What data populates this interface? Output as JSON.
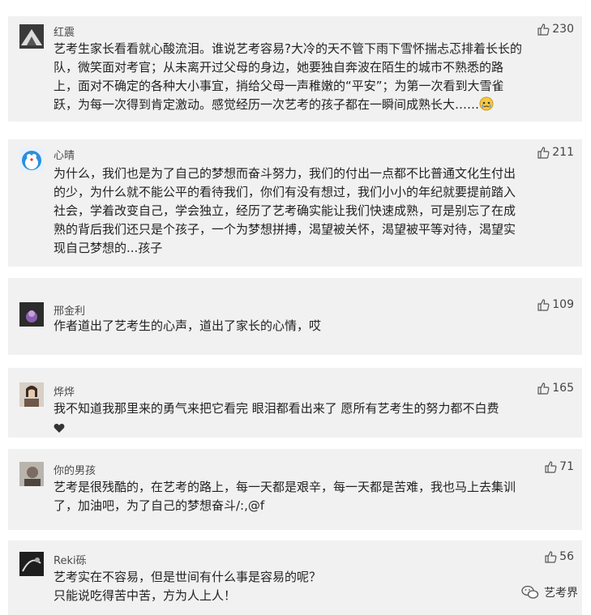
{
  "comments": [
    {
      "username": "红震",
      "likes": "230",
      "text": "艺考生家长看看就心酸流泪。谁说艺考容易?大冷的天不管下雨下雪怀揣忐忑排着长长的\n队，微笑面对考官；从未离开过父母的身边，她要独自奔波在陌生的城市不熟悉的路\n上，面对不确定的各种大小事宜，捎给父母一声稚嫩的“平安”；为第一次看到大雪雀\n跃，为每一次得到肯定激动。感觉经历一次艺考的孩子都在一瞬间成熟长大……"
    },
    {
      "username": "心晴",
      "likes": "211",
      "text": "为什么，我们也是为了自己的梦想而奋斗努力，我们的付出一点都不比普通文化生付出\n的少，为什么就不能公平的看待我们，你们有没有想过，我们小小的年纪就要提前踏入\n社会，学着改变自己，学会独立，经历了艺考确实能让我们快速成熟，可是别忘了在成\n熟的背后我们还只是个孩子，一个为梦想拼搏，渴望被关怀，渴望被平等对待，渴望实\n现自己梦想的...孩子"
    },
    {
      "username": "邢金利",
      "likes": "109",
      "text": "作者道出了艺考生的心声，道出了家长的心情，哎"
    },
    {
      "username": "烨烨",
      "likes": "165",
      "text": "我不知道我那里来的勇气来把它看完   眼泪都看出来了   愿所有艺考生的努力都不白费"
    },
    {
      "username": "你的男孩",
      "likes": "71",
      "text": "艺考是很残酷的，在艺考的路上，每一天都是艰辛，每一天都是苦难，我也马上去集训\n了，加油吧，为了自己的梦想奋斗/:,@f"
    },
    {
      "username": "Reki砾",
      "likes": "56",
      "text": "艺考实在不容易，但是世间有什么事是容易的呢？\n只能说吃得苦中苦，方为人上人！"
    }
  ],
  "watermark": {
    "text": "艺考界"
  },
  "icons": {
    "like": "thumbs-up-icon",
    "wechat": "wechat-icon"
  },
  "colors": {
    "card_bg": "#f1f1f1",
    "text": "#222222",
    "username": "#4a4a4a"
  }
}
